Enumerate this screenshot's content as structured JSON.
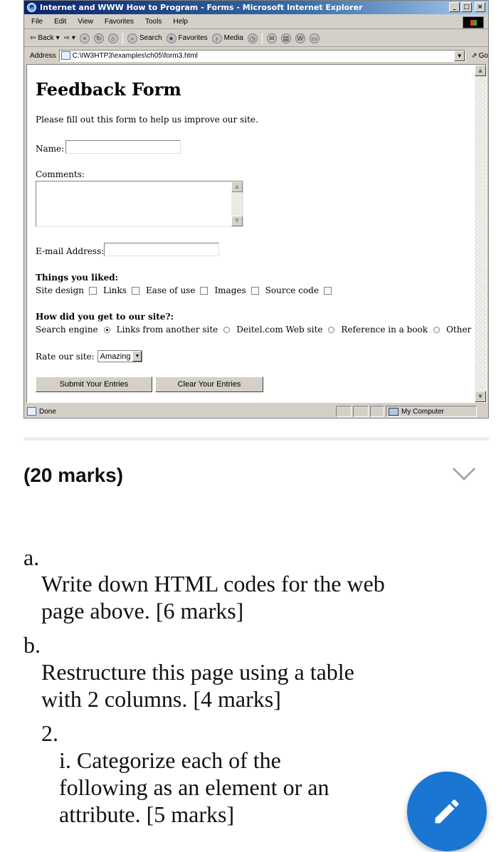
{
  "browser": {
    "title": "Internet and WWW How to Program - Forms - Microsoft Internet Explorer",
    "window_buttons": [
      "_",
      "□",
      "×"
    ],
    "menu": [
      "File",
      "Edit",
      "View",
      "Favorites",
      "Tools",
      "Help"
    ],
    "toolbar": {
      "back": "Back",
      "search": "Search",
      "favorites": "Favorites",
      "media": "Media"
    },
    "address_label": "Address",
    "address_value": "C:\\IW3HTP3\\examples\\ch05\\form3.html",
    "go_label": "Go",
    "status_text": "Done",
    "zone_text": "My Computer"
  },
  "form": {
    "heading": "Feedback Form",
    "intro": "Please fill out this form to help us improve our site.",
    "name_label": "Name:",
    "comments_label": "Comments:",
    "email_label": "E-mail Address:",
    "liked_heading": "Things you liked:",
    "liked_options": [
      "Site design",
      "Links",
      "Ease of use",
      "Images",
      "Source code"
    ],
    "how_heading": "How did you get to our site?:",
    "how_options": [
      "Search engine",
      "Links from another site",
      "Deitel.com Web site",
      "Reference in a book",
      "Other"
    ],
    "how_selected": "Search engine",
    "rate_label": "Rate our site:",
    "rate_value": "Amazing",
    "submit_label": "Submit Your Entries",
    "clear_label": "Clear Your Entries"
  },
  "question": {
    "marks": "(20 marks)",
    "a_label": "a.",
    "a_text_1": "Write down HTML codes for the web",
    "a_text_2": "page above. [6 marks]",
    "b_label": "b.",
    "b_text_1": "Restructure this page using a table",
    "b_text_2": "with 2 columns. [4 marks]",
    "q2_label": "2.",
    "q2_i_1": "i. Categorize each of the",
    "q2_i_2": "following as an element or an",
    "q2_i_3": "attribute. [5 marks]"
  },
  "colors": {
    "fab": "#1976d2",
    "titlebar": "#0a246a"
  }
}
